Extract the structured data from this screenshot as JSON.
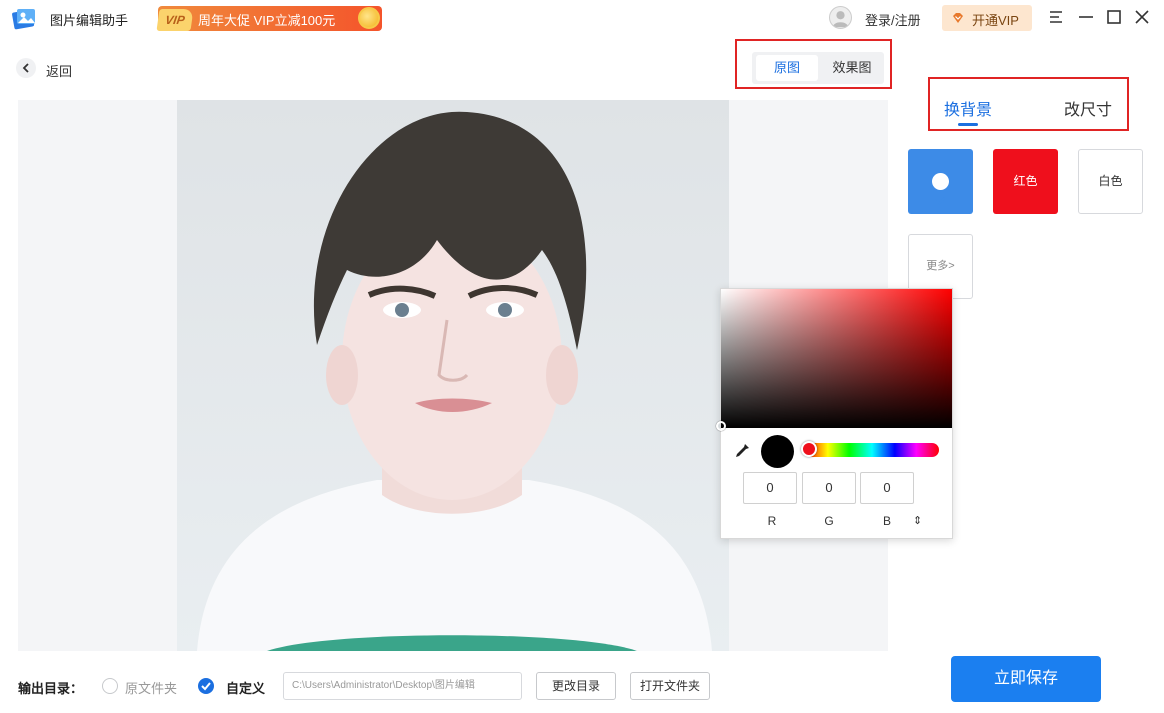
{
  "titlebar": {
    "app_title": "图片编辑助手",
    "promo_vip": "VIP",
    "promo_text": "周年大促 VIP立减100元",
    "login": "登录/注册",
    "vip_button": "开通VIP",
    "icons": [
      "menu-icon",
      "minimize-icon",
      "maximize-icon",
      "close-icon"
    ]
  },
  "back": {
    "label": "返回"
  },
  "view_toggle": {
    "original": "原图",
    "result": "效果图",
    "active": "原图"
  },
  "panel": {
    "tabs": [
      {
        "label": "换背景"
      },
      {
        "label": "改尺寸"
      }
    ],
    "active_tab": "换背景",
    "swatches": {
      "selected_color": "#3d8be7",
      "red": "红色",
      "white": "白色",
      "more": "更多>"
    }
  },
  "picker": {
    "r": "0",
    "g": "0",
    "b": "0",
    "r_label": "R",
    "g_label": "G",
    "b_label": "B",
    "mode_toggle": "⇕",
    "current_color": "#000000"
  },
  "bottom": {
    "output_label": "输出目录：",
    "option_source": "原文件夹",
    "option_custom": "自定义",
    "path": "C:\\Users\\Administrator\\Desktop\\图片编辑",
    "change_dir": "更改目录",
    "open_folder": "打开文件夹",
    "save": "立即保存"
  },
  "colors": {
    "accent": "#1b6fe0",
    "save_button": "#1b7ff0",
    "highlight": "#e02424"
  }
}
